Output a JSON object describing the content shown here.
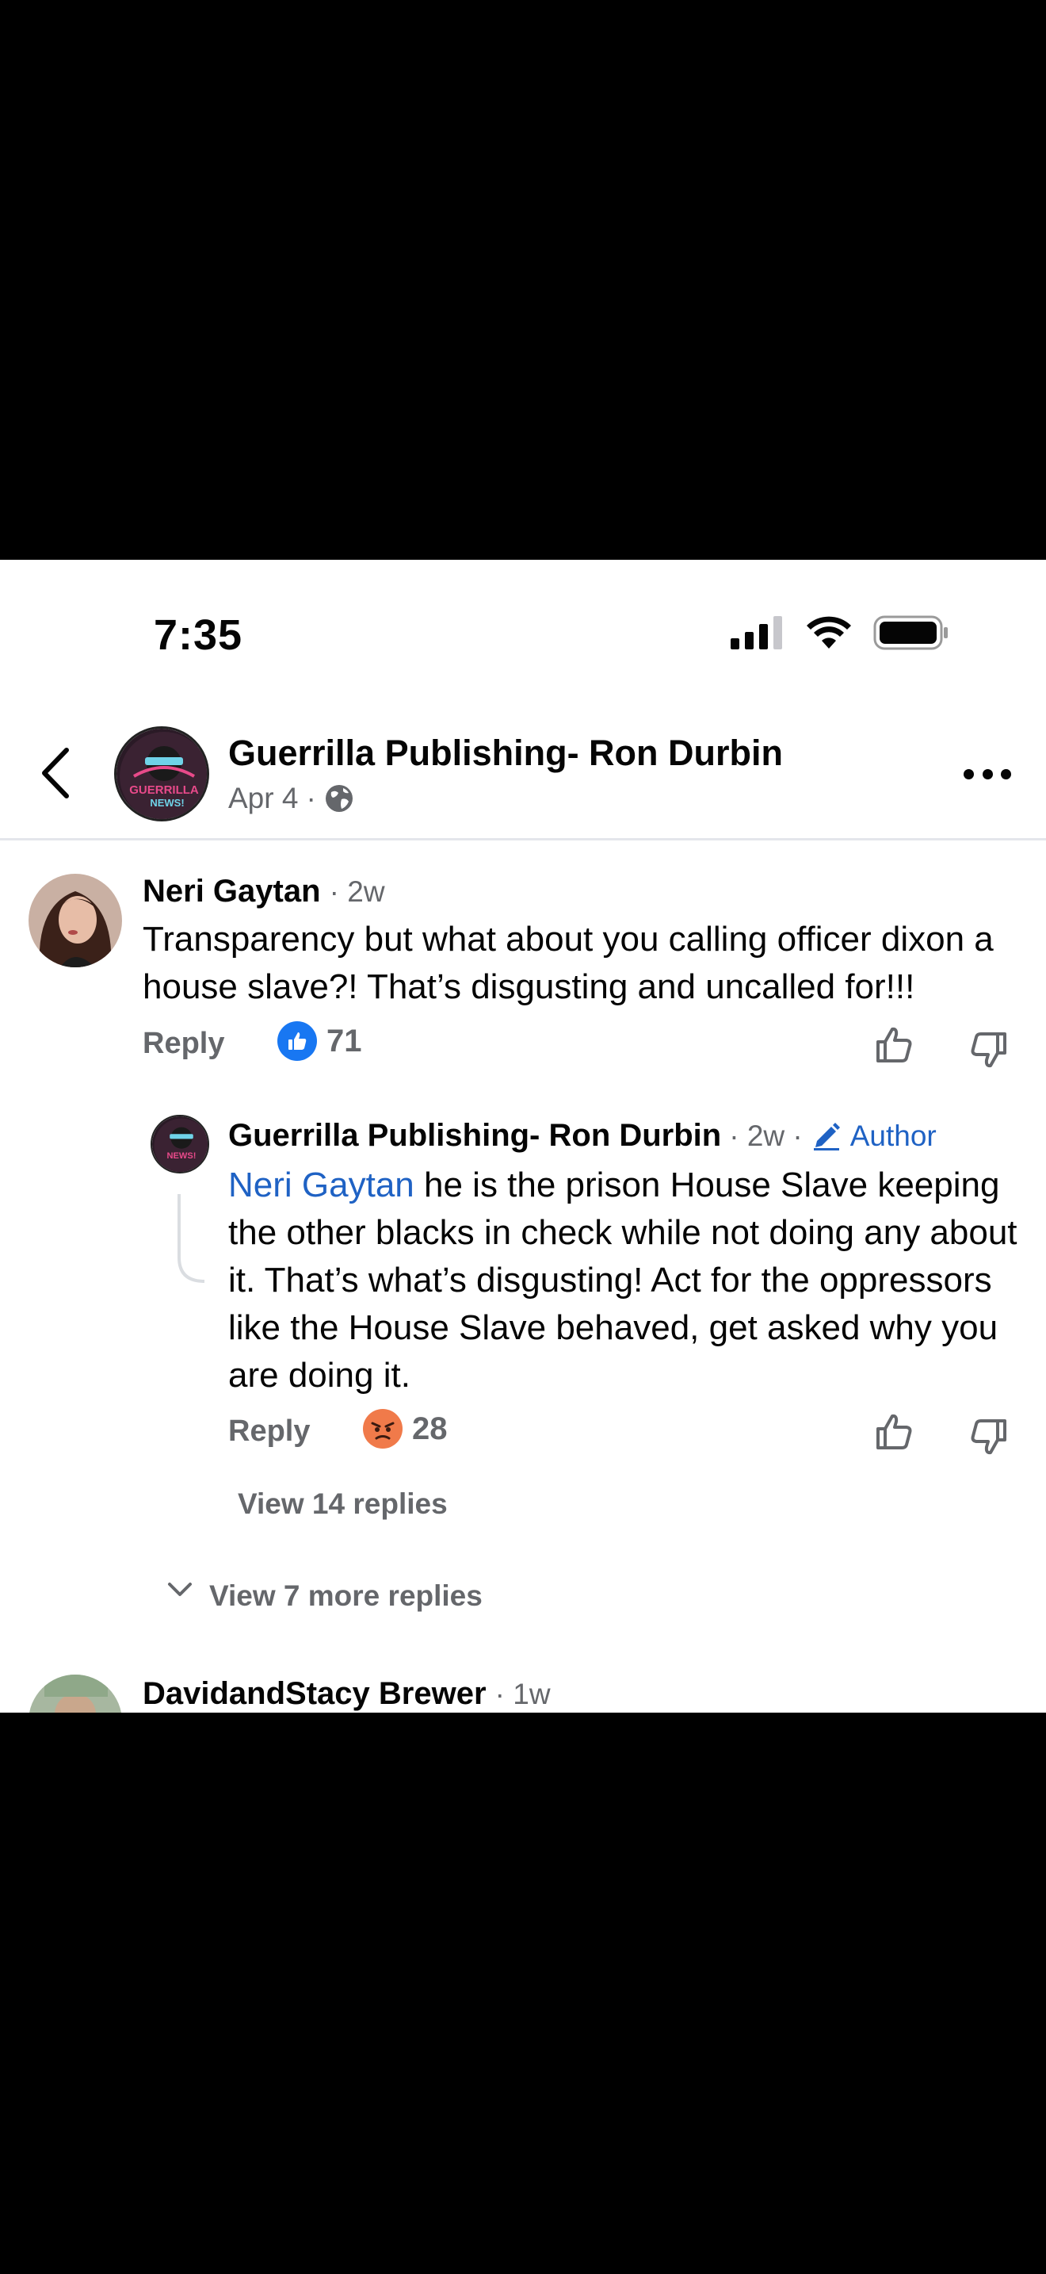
{
  "status_bar": {
    "time": "7:35"
  },
  "header": {
    "page_name": "Guerrilla Publishing- Ron Durbin",
    "post_date": "Apr 4",
    "separator": "·",
    "avatar_text_line1": "GUERRILLA",
    "avatar_text_line2": "NEWS!"
  },
  "comments": [
    {
      "author": "Neri Gaytan",
      "time": "· 2w",
      "text": "Transparency but what about you calling officer dixon a house slave?! That’s disgusting and uncalled for!!!",
      "reply_label": "Reply",
      "reaction": "like-reaction",
      "reaction_count": "71"
    },
    {
      "author": "Guerrilla Publishing- Ron Durbin",
      "time": "· 2w ·",
      "author_label": "Author",
      "mention": "Neri Gaytan",
      "text": "he is the prison House Slave keeping the other blacks in check while not doing any about it. That’s what’s disgusting! Act for the oppressors like the House Slave behaved, get asked why you are doing it.",
      "reply_label": "Reply",
      "reaction": "angry-reaction",
      "reaction_count": "28",
      "view_replies": "View 14 replies"
    },
    {
      "author": "DavidandStacy Brewer",
      "time": "· 1w"
    }
  ],
  "more_replies": "View 7 more replies",
  "colors": {
    "accent_blue": "#1f62c4",
    "secondary_text": "#65676b",
    "divider": "#e4e6eb",
    "angry_orange": "#f07a4a"
  }
}
